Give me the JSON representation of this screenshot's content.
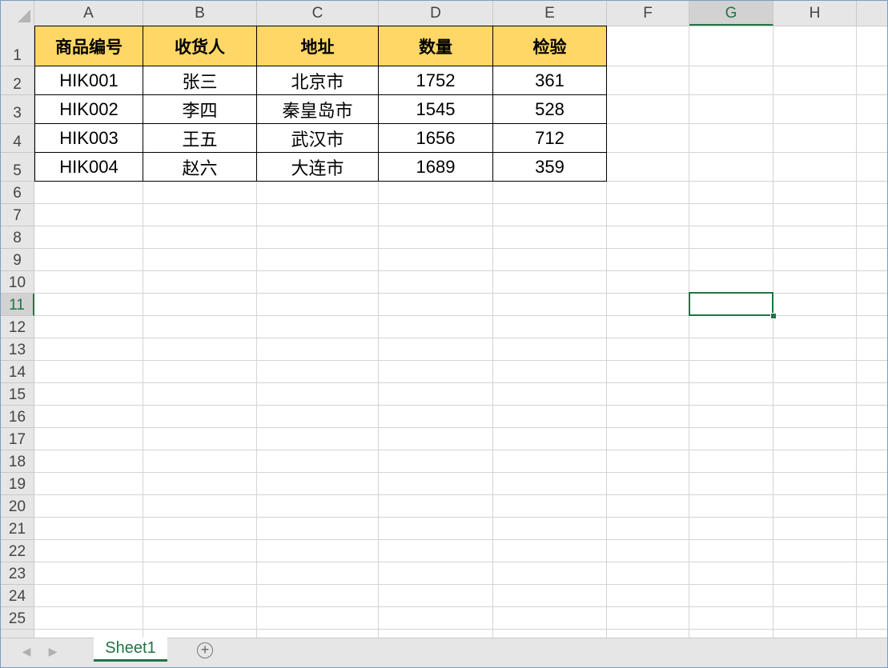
{
  "columns": [
    "A",
    "B",
    "C",
    "D",
    "E",
    "F",
    "G",
    "H"
  ],
  "rows": [
    "1",
    "2",
    "3",
    "4",
    "5",
    "6",
    "7",
    "8",
    "9",
    "10",
    "11",
    "12",
    "13",
    "14",
    "15",
    "16",
    "17",
    "18",
    "19",
    "20",
    "21",
    "22",
    "23",
    "24",
    "25"
  ],
  "active_column": "G",
  "active_row": "11",
  "table": {
    "headers": [
      "商品编号",
      "收货人",
      "地址",
      "数量",
      "检验"
    ],
    "rows": [
      [
        "HIK001",
        "张三",
        "北京市",
        "1752",
        "361"
      ],
      [
        "HIK002",
        "李四",
        "秦皇岛市",
        "1545",
        "528"
      ],
      [
        "HIK003",
        "王五",
        "武汉市",
        "1656",
        "712"
      ],
      [
        "HIK004",
        "赵六",
        "大连市",
        "1689",
        "359"
      ]
    ]
  },
  "colors": {
    "header_fill": "#ffd766",
    "accent_green": "#217346"
  },
  "sheets": [
    "Sheet1"
  ],
  "icons": {
    "prev_sheet": "chevron-left-icon",
    "next_sheet": "chevron-right-icon",
    "add_sheet": "plus-circle-icon"
  }
}
